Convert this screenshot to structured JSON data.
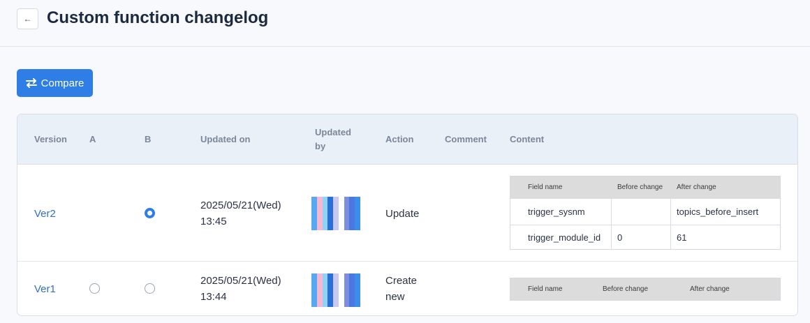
{
  "header": {
    "title": "Custom function changelog",
    "back_icon": "←"
  },
  "toolbar": {
    "compare_label": "Compare",
    "accent": "#2f7ee6"
  },
  "table": {
    "columns": {
      "version": "Version",
      "a": "A",
      "b": "B",
      "updated_on": "Updated on",
      "updated_by_1": "Updated",
      "updated_by_2": "by",
      "action": "Action",
      "comment": "Comment",
      "content": "Content"
    },
    "rows": [
      {
        "version": "Ver2",
        "radio_a": "none",
        "radio_b": "checked",
        "date": "2025/05/21(Wed)",
        "time": "13:45",
        "action_1": "Update",
        "action_2": "",
        "comment": "",
        "content": {
          "headers": [
            "Field name",
            "Before change",
            "After change"
          ],
          "rows": [
            [
              "trigger_sysnm",
              "",
              "topics_before_insert"
            ],
            [
              "trigger_module_id",
              "0",
              "61"
            ]
          ]
        }
      },
      {
        "version": "Ver1",
        "radio_a": "unchecked",
        "radio_b": "unchecked",
        "date": "2025/05/21(Wed)",
        "time": "13:44",
        "action_1": "Create",
        "action_2": "new",
        "comment": "",
        "content": {
          "headers": [
            "Field name",
            "Before change",
            "After change"
          ],
          "rows": []
        }
      }
    ]
  },
  "avatar_colors": [
    "#58a8f0",
    "#f4b8d4",
    "#8fd3f5",
    "#2a6fd8",
    "#c9c8f0",
    "#ffffff",
    "#7b8ee0",
    "#4a78e0",
    "#3a8ee8"
  ]
}
